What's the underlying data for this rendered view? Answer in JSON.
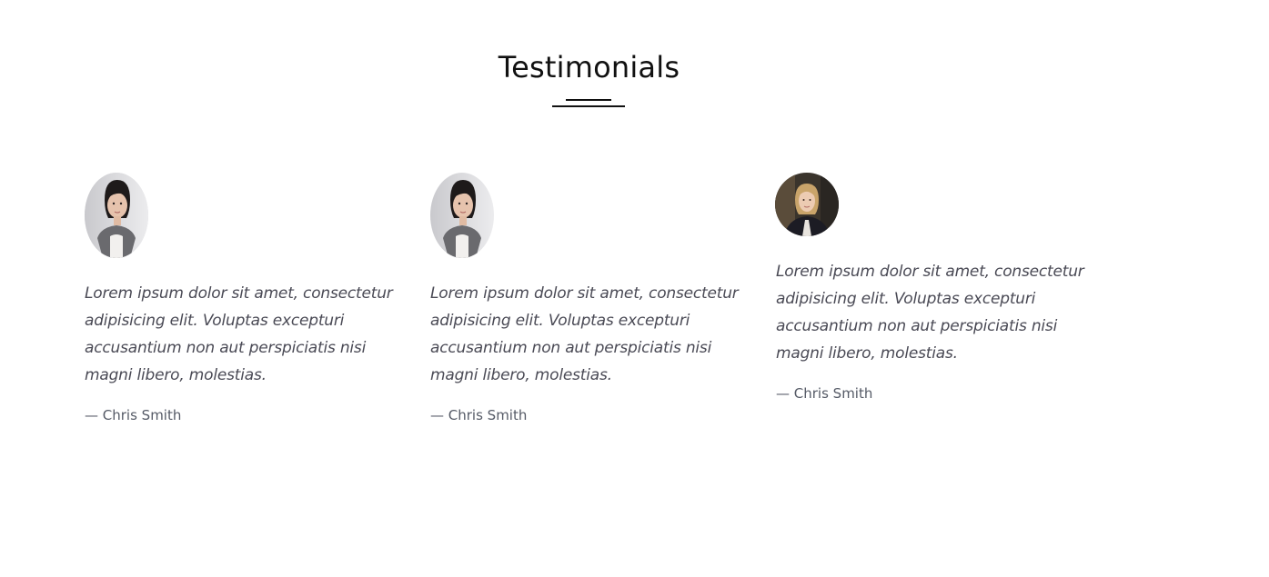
{
  "section": {
    "title": "Testimonials"
  },
  "testimonials": [
    {
      "quote": "Lorem ipsum dolor sit amet, consectetur adipisicing elit. Voluptas excepturi accusantium non aut perspiciatis nisi magni libero, molestias.",
      "author": "— Chris Smith",
      "avatar_icon": "woman-portrait-photo"
    },
    {
      "quote": "Lorem ipsum dolor sit amet, consectetur adipisicing elit. Voluptas excepturi accusantium non aut perspiciatis nisi magni libero, molestias.",
      "author": "— Chris Smith",
      "avatar_icon": "woman-portrait-photo"
    },
    {
      "quote": "Lorem ipsum dolor sit amet, consectetur adipisicing elit. Voluptas excepturi accusantium non aut perspiciatis nisi magni libero, molestias.",
      "author": "— Chris Smith",
      "avatar_icon": "blonde-woman-portrait-photo"
    }
  ],
  "colors": {
    "heading": "#111111",
    "quote_text": "#4a4a55",
    "author_text": "#555a66",
    "background": "#ffffff"
  }
}
